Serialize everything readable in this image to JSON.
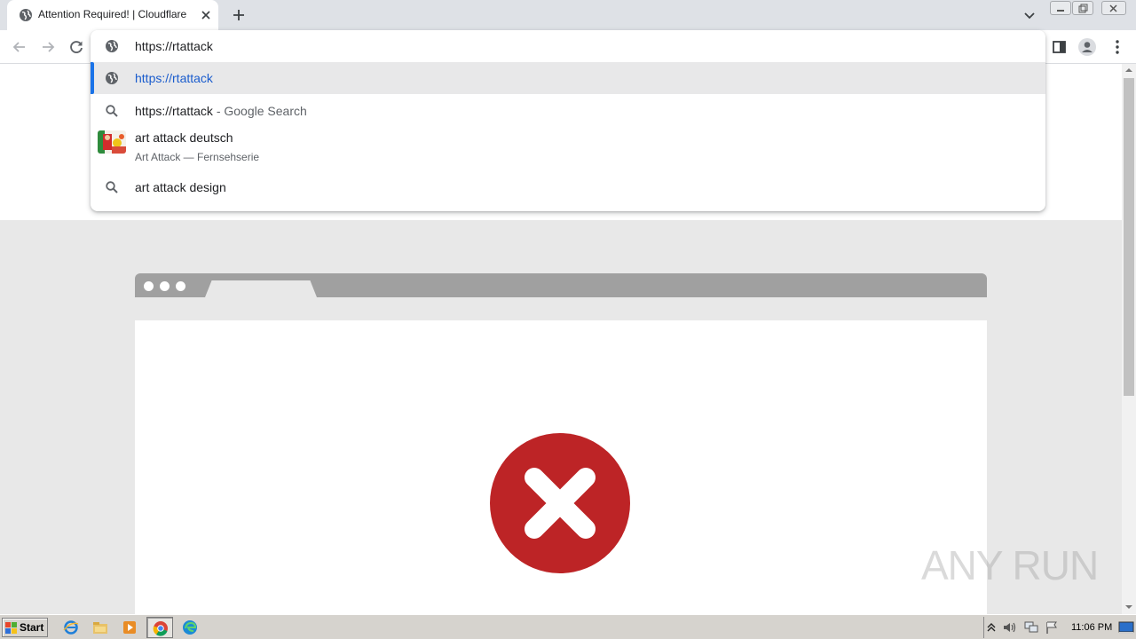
{
  "browser": {
    "tab": {
      "title": "Attention Required! | Cloudflare"
    },
    "address_input": "https://rtattack"
  },
  "omnibox": {
    "suggestions": [
      {
        "kind": "url",
        "text": "https://rtattack",
        "icon": "globe-icon"
      },
      {
        "kind": "search",
        "text": "https://rtattack",
        "suffix": " - Google Search",
        "icon": "search-icon"
      },
      {
        "kind": "entity",
        "text": "art attack deutsch",
        "subtext": "Art Attack — Fernsehserie",
        "icon": "entity-thumbnail"
      },
      {
        "kind": "search",
        "text": "art attack design",
        "icon": "search-icon"
      }
    ]
  },
  "page": {
    "error_color": "#bd2426"
  },
  "watermark": {
    "text": "ANY RUN"
  },
  "taskbar": {
    "start_label": "Start",
    "clock": "11:06 PM"
  }
}
